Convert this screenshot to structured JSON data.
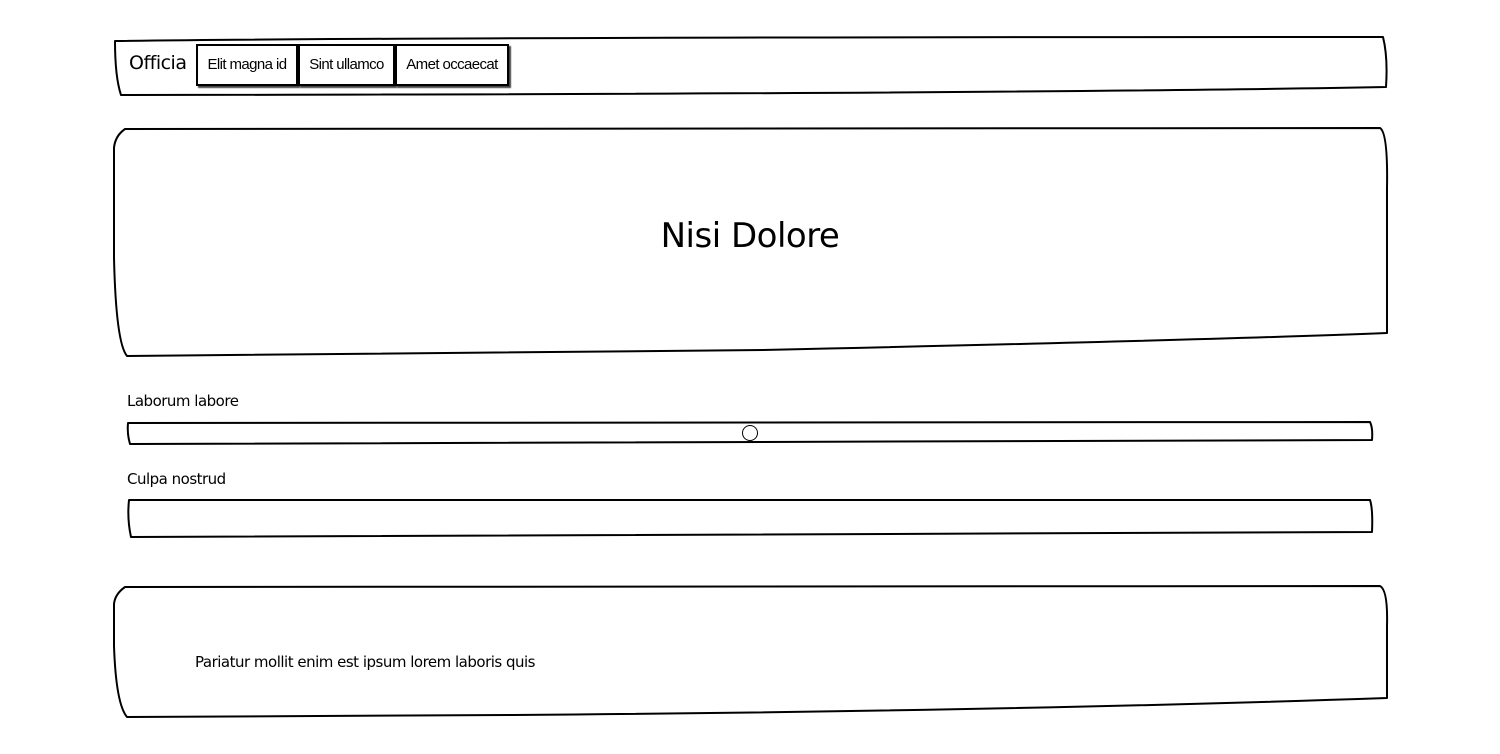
{
  "navbar": {
    "brand": "Officia",
    "links": [
      {
        "label": "Elit magna id"
      },
      {
        "label": "Sint ullamco"
      },
      {
        "label": "Amet occaecat"
      }
    ]
  },
  "hero": {
    "title": "Nisi Dolore"
  },
  "form": {
    "slider": {
      "label": "Laborum labore",
      "value_fraction": 0.5
    },
    "text_field": {
      "label": "Culpa nostrud",
      "value": ""
    }
  },
  "footer": {
    "text": "Pariatur mollit enim est ipsum lorem laboris quis"
  }
}
